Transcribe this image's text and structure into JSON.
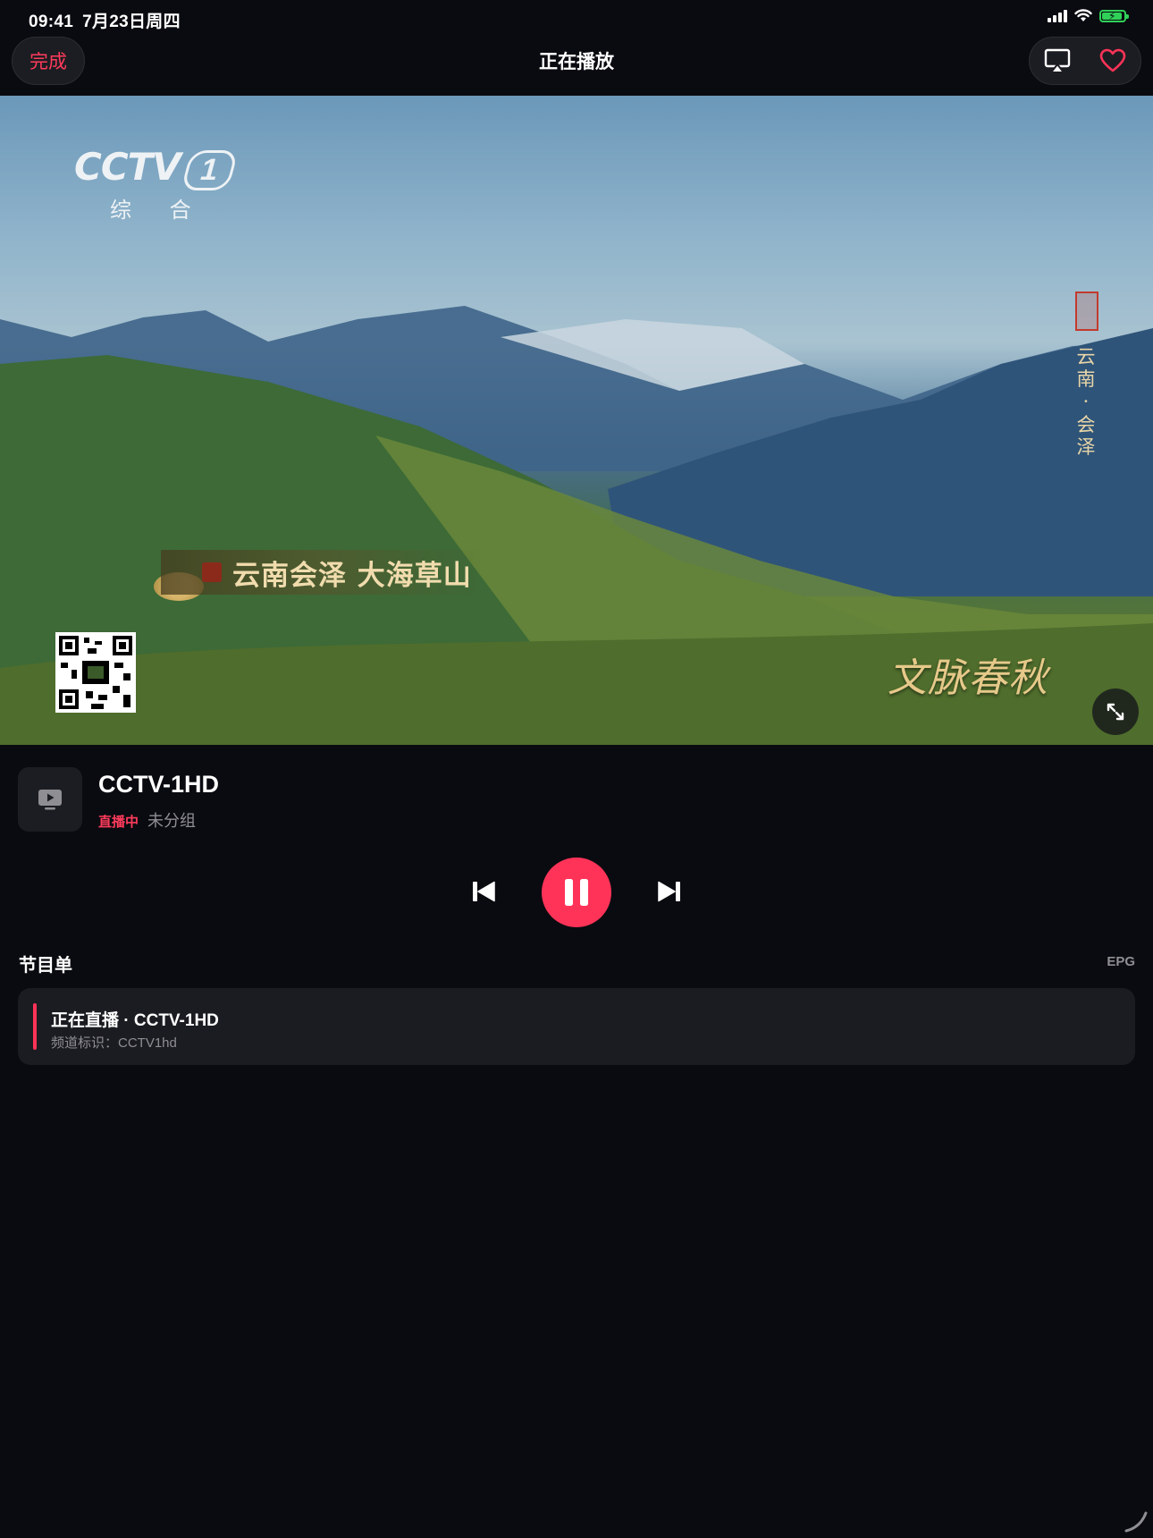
{
  "status_bar": {
    "time": "09:41",
    "date": "7月23日周四",
    "battery_charging": true
  },
  "nav": {
    "done_label": "完成",
    "title": "正在播放",
    "airplay_icon": "airplay-icon",
    "favorite_icon": "heart-icon"
  },
  "video": {
    "logo_text": "CCTV",
    "logo_channel_number": "1",
    "logo_subtitle": "综 合",
    "caption": "云南会泽 大海草山",
    "vertical_text": "云南·会泽",
    "program_watermark": "文脉春秋",
    "expand_icon": "expand-icon"
  },
  "channel": {
    "name": "CCTV-1HD",
    "live_badge": "直播中",
    "group": "未分组",
    "thumb_icon": "tv-play-icon"
  },
  "controls": {
    "prev_icon": "skip-back-icon",
    "pause_icon": "pause-icon",
    "next_icon": "skip-forward-icon"
  },
  "program_list": {
    "title": "节目单",
    "epg_label": "EPG",
    "items": [
      {
        "title": "正在直播 · CCTV-1HD",
        "subtitle": "频道标识：CCTV1hd"
      }
    ]
  },
  "colors": {
    "accent": "#ff3358",
    "background": "#0a0b10",
    "card": "#1b1c21",
    "secondary_text": "#8e8e93"
  }
}
